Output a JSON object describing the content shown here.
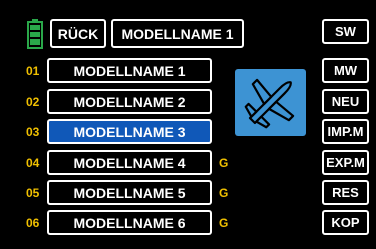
{
  "header": {
    "back_label": "RÜCK",
    "model_title": "MODELLNAME 1",
    "battery_icon": "battery-icon",
    "battery_color": "#2aa84a"
  },
  "models": [
    {
      "number": "01",
      "name": "MODELLNAME 1",
      "flag": "",
      "selected": false
    },
    {
      "number": "02",
      "name": "MODELLNAME 2",
      "flag": "",
      "selected": false
    },
    {
      "number": "03",
      "name": "MODELLNAME 3",
      "flag": "",
      "selected": true
    },
    {
      "number": "04",
      "name": "MODELLNAME 4",
      "flag": "G",
      "selected": false
    },
    {
      "number": "05",
      "name": "MODELLNAME 5",
      "flag": "G",
      "selected": false
    },
    {
      "number": "06",
      "name": "MODELLNAME 6",
      "flag": "G",
      "selected": false
    }
  ],
  "model_type_icon": "airplane-icon",
  "side_buttons": [
    "SW",
    "MW",
    "NEU",
    "IMP.M",
    "EXP.M",
    "RES",
    "KOP"
  ],
  "colors": {
    "background": "#000000",
    "selected": "#1058b8",
    "number": "#f0c000",
    "icon_bg": "#3d93d3"
  }
}
